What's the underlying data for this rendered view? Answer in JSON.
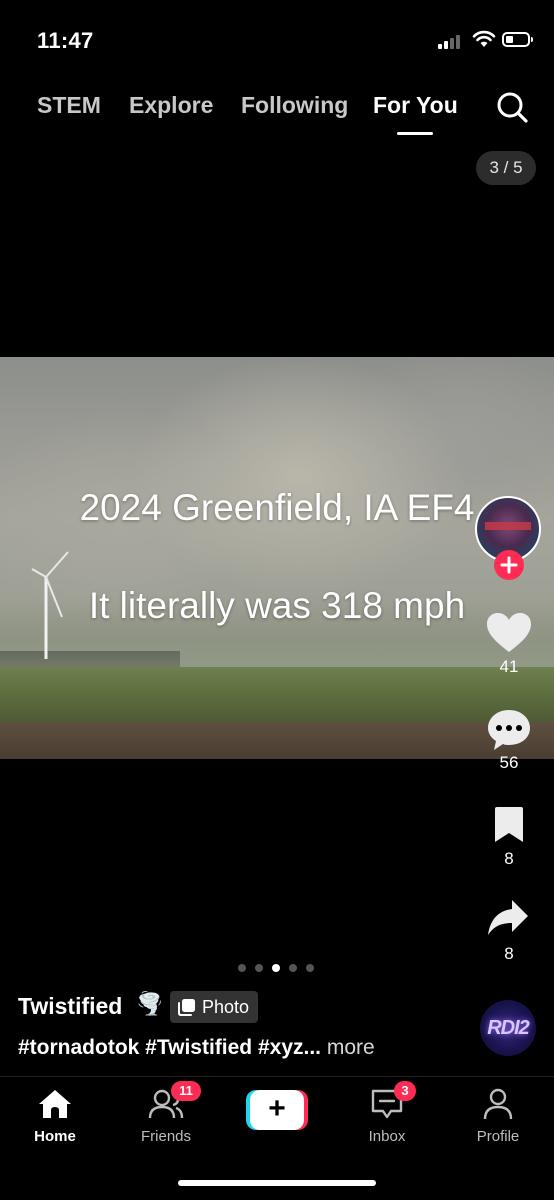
{
  "status_bar": {
    "time": "11:47"
  },
  "top_nav": {
    "tabs": [
      {
        "label": "STEM"
      },
      {
        "label": "Explore"
      },
      {
        "label": "Following"
      },
      {
        "label": "For You",
        "active": true
      }
    ]
  },
  "photo_counter": "3 / 5",
  "post": {
    "overlay_lines": [
      "2024 Greenfield, IA EF4",
      "It literally was 318 mph"
    ],
    "author": "Twistified",
    "author_emoji": "🌪️",
    "type_badge": "Photo",
    "caption": "#tornadotok #Twistified #xyz...",
    "caption_more": "more",
    "current_slide": 3,
    "total_slides": 5
  },
  "actions": {
    "likes": "41",
    "comments": "56",
    "bookmarks": "8",
    "shares": "8"
  },
  "sound_disc_text": "RDI2",
  "bottom_nav": {
    "items": [
      {
        "label": "Home",
        "icon": "home-icon",
        "active": true
      },
      {
        "label": "Friends",
        "icon": "friends-icon",
        "badge": "11"
      },
      {
        "label": "",
        "icon": "plus-icon"
      },
      {
        "label": "Inbox",
        "icon": "inbox-icon",
        "badge": "3"
      },
      {
        "label": "Profile",
        "icon": "profile-icon"
      }
    ]
  },
  "colors": {
    "accent_red": "#fe2c55",
    "accent_cyan": "#20d5ec",
    "background": "#000000"
  }
}
